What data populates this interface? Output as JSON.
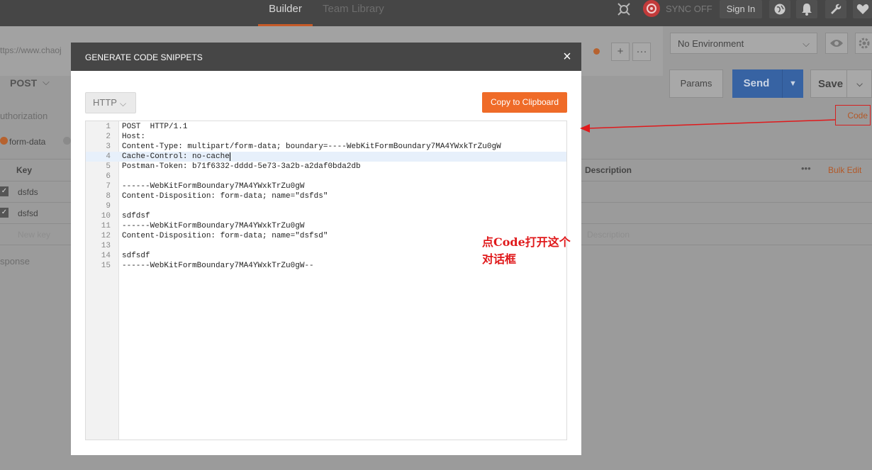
{
  "topbar": {
    "tab_builder": "Builder",
    "tab_team_library": "Team Library",
    "sync_label": "SYNC OFF",
    "sign_in": "Sign In"
  },
  "request": {
    "url_partial": "ttps://www.chaoj",
    "method": "POST",
    "environment": "No Environment",
    "params_label": "Params",
    "send_label": "Send",
    "save_label": "Save",
    "auth_tab": "uthorization",
    "code_link": "Code",
    "body_mode": "form-data"
  },
  "params_table": {
    "col_key": "Key",
    "col_description": "Description",
    "bulk_edit": "Bulk Edit",
    "rows": [
      {
        "key": "dsfds",
        "checked": true
      },
      {
        "key": "dsfsd",
        "checked": true
      }
    ],
    "new_key_placeholder": "New key",
    "description_placeholder": "Description"
  },
  "response_label": "sponse",
  "modal": {
    "title": "GENERATE CODE SNIPPETS",
    "close": "×",
    "language": "HTTP",
    "copy_button": "Copy to Clipboard",
    "current_line": 4,
    "lines": [
      "POST  HTTP/1.1",
      "Host: ",
      "Content-Type: multipart/form-data; boundary=----WebKitFormBoundary7MA4YWxkTrZu0gW",
      "Cache-Control: no-cache",
      "Postman-Token: b71f6332-dddd-5e73-3a2b-a2daf0bda2db",
      "",
      "------WebKitFormBoundary7MA4YWxkTrZu0gW",
      "Content-Disposition: form-data; name=\"dsfds\"",
      "",
      "sdfdsf",
      "------WebKitFormBoundary7MA4YWxkTrZu0gW",
      "Content-Disposition: form-data; name=\"dsfsd\"",
      "",
      "sdfsdf",
      "------WebKitFormBoundary7MA4YWxkTrZu0gW--"
    ]
  },
  "annotation": "点Code打开这个对话框",
  "colors": {
    "accent_orange": "#ef6b28",
    "annotation_red": "#e0191b",
    "send_blue": "#3763a3"
  }
}
